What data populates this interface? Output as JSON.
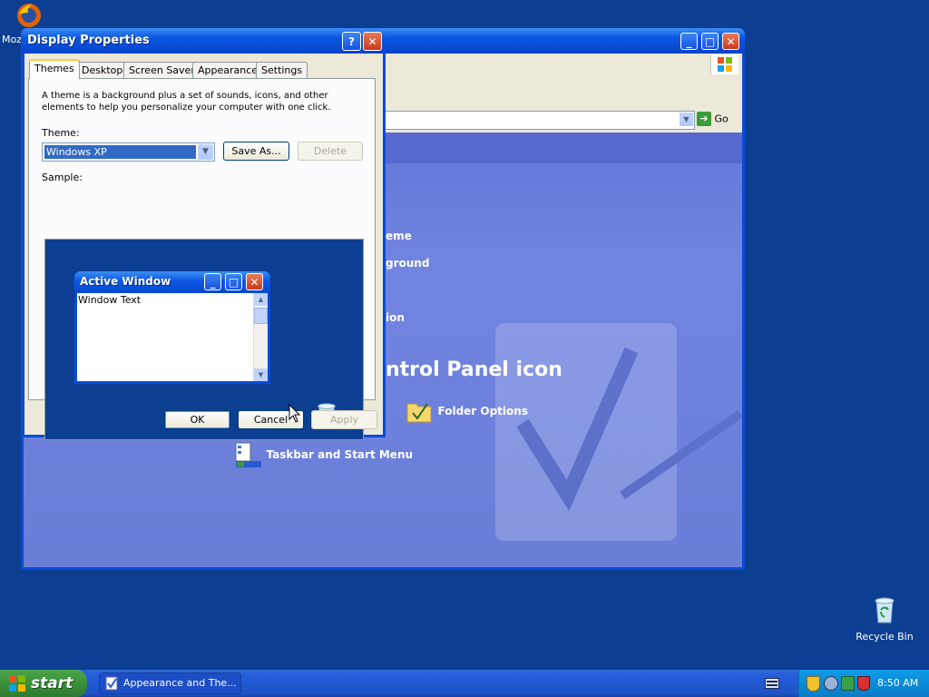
{
  "desktop": {
    "firefox_label": "Moz",
    "recycle_bin_label": "Recycle Bin"
  },
  "control_panel": {
    "address_go_label": "Go",
    "links": {
      "theme_fragment": "eme",
      "background_fragment": "ground",
      "ion_fragment": "ion",
      "pick_icon_fragment": "ntrol Panel icon",
      "folder_options": "Folder Options",
      "taskbar_start_menu": "Taskbar and Start Menu"
    }
  },
  "dialog": {
    "title": "Display Properties",
    "help_glyph": "?",
    "close_glyph": "✕",
    "tabs": [
      "Themes",
      "Desktop",
      "Screen Saver",
      "Appearance",
      "Settings"
    ],
    "description": "A theme is a background plus a set of sounds, icons, and other elements to help you personalize your computer with one click.",
    "theme_label": "Theme:",
    "theme_value": "Windows XP",
    "save_as_label": "Save As...",
    "delete_label": "Delete",
    "sample_label": "Sample:",
    "sample_window": {
      "title": "Active Window",
      "text": "Window Text"
    },
    "ok_label": "OK",
    "cancel_label": "Cancel",
    "apply_label": "Apply"
  },
  "taskbar": {
    "start_label": "start",
    "task_button_label": "Appearance and The...",
    "clock": "8:50 AM"
  },
  "colors": {
    "desktop": "#0c3f92",
    "titlebar": "#0a55e3",
    "start_green": "#3c8f3c",
    "tray_blue": "#0c8ad7"
  }
}
